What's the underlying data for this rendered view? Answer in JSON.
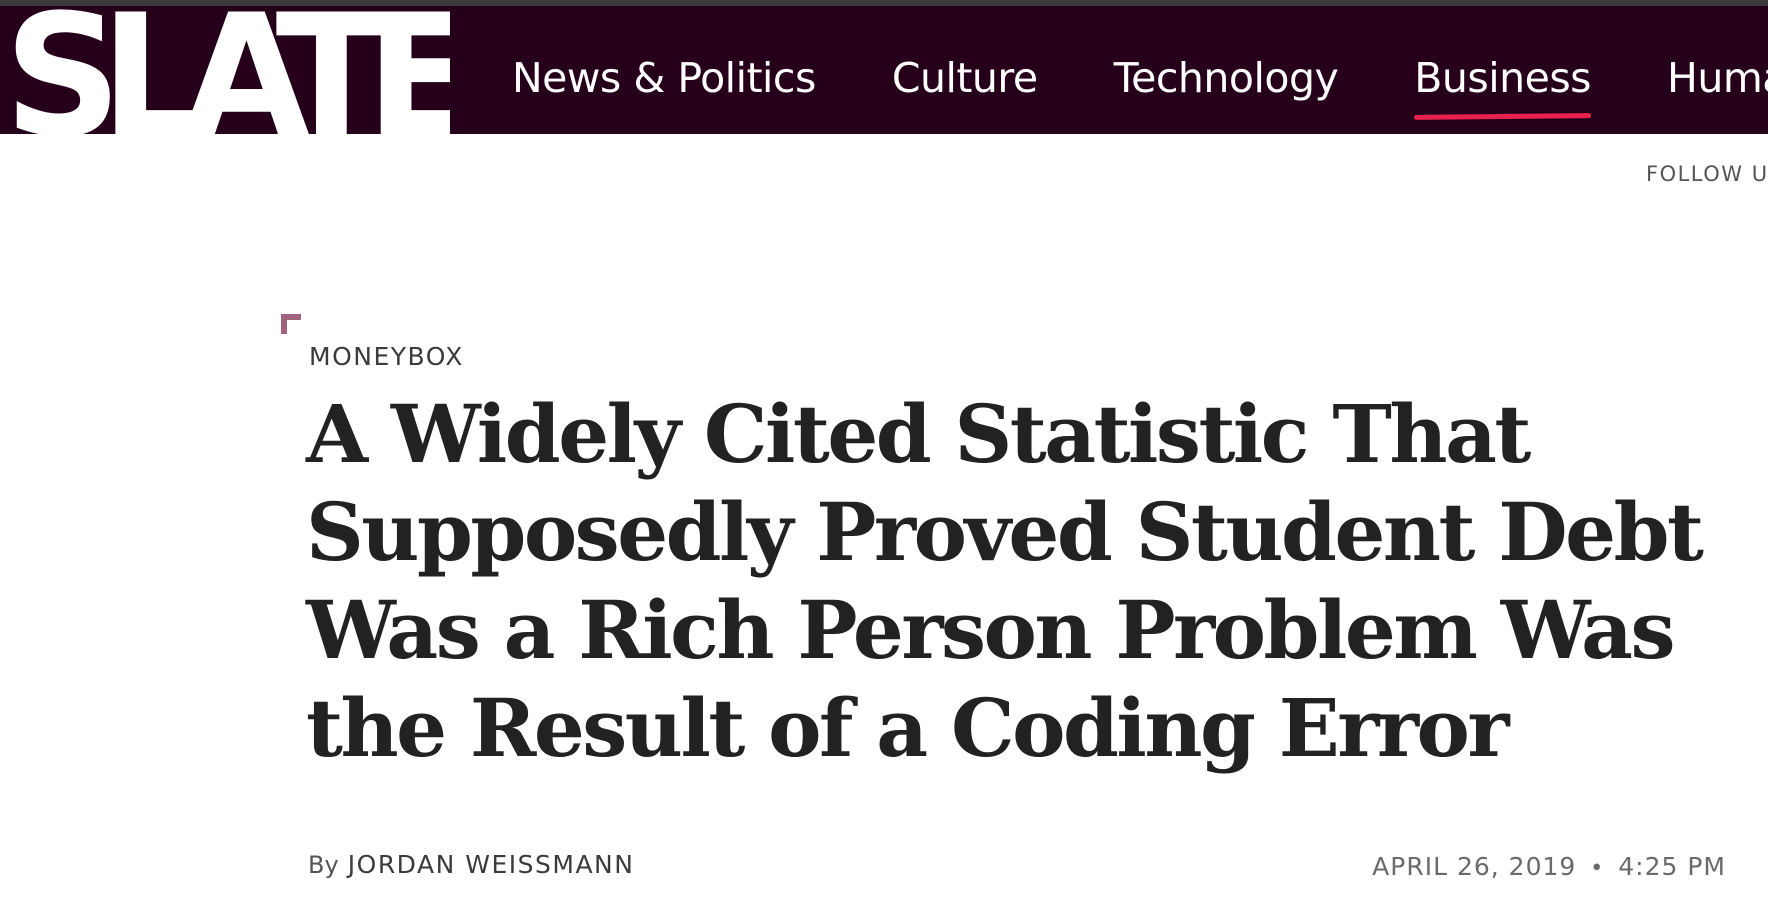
{
  "brand": {
    "logo_text": "SLATE",
    "background_color": "#26001b",
    "accent_color": "#e8224a"
  },
  "nav": {
    "items": [
      {
        "label": "News & Politics",
        "active": false
      },
      {
        "label": "Culture",
        "active": false
      },
      {
        "label": "Technology",
        "active": false
      },
      {
        "label": "Business",
        "active": true
      },
      {
        "label": "Huma",
        "active": false
      }
    ]
  },
  "social": {
    "follow_label": "FOLLOW U"
  },
  "article": {
    "kicker": "MONEYBOX",
    "headline": "A Widely Cited Statistic That Supposedly Proved Student Debt Was a Rich Person Problem Was the Result of a Coding Error",
    "byline_prefix": "By",
    "author": "JORDAN WEISSMANN",
    "date": "APRIL 26, 2019",
    "separator": "•",
    "time": "4:25 PM",
    "corner_mark_color": "#a0627f"
  }
}
